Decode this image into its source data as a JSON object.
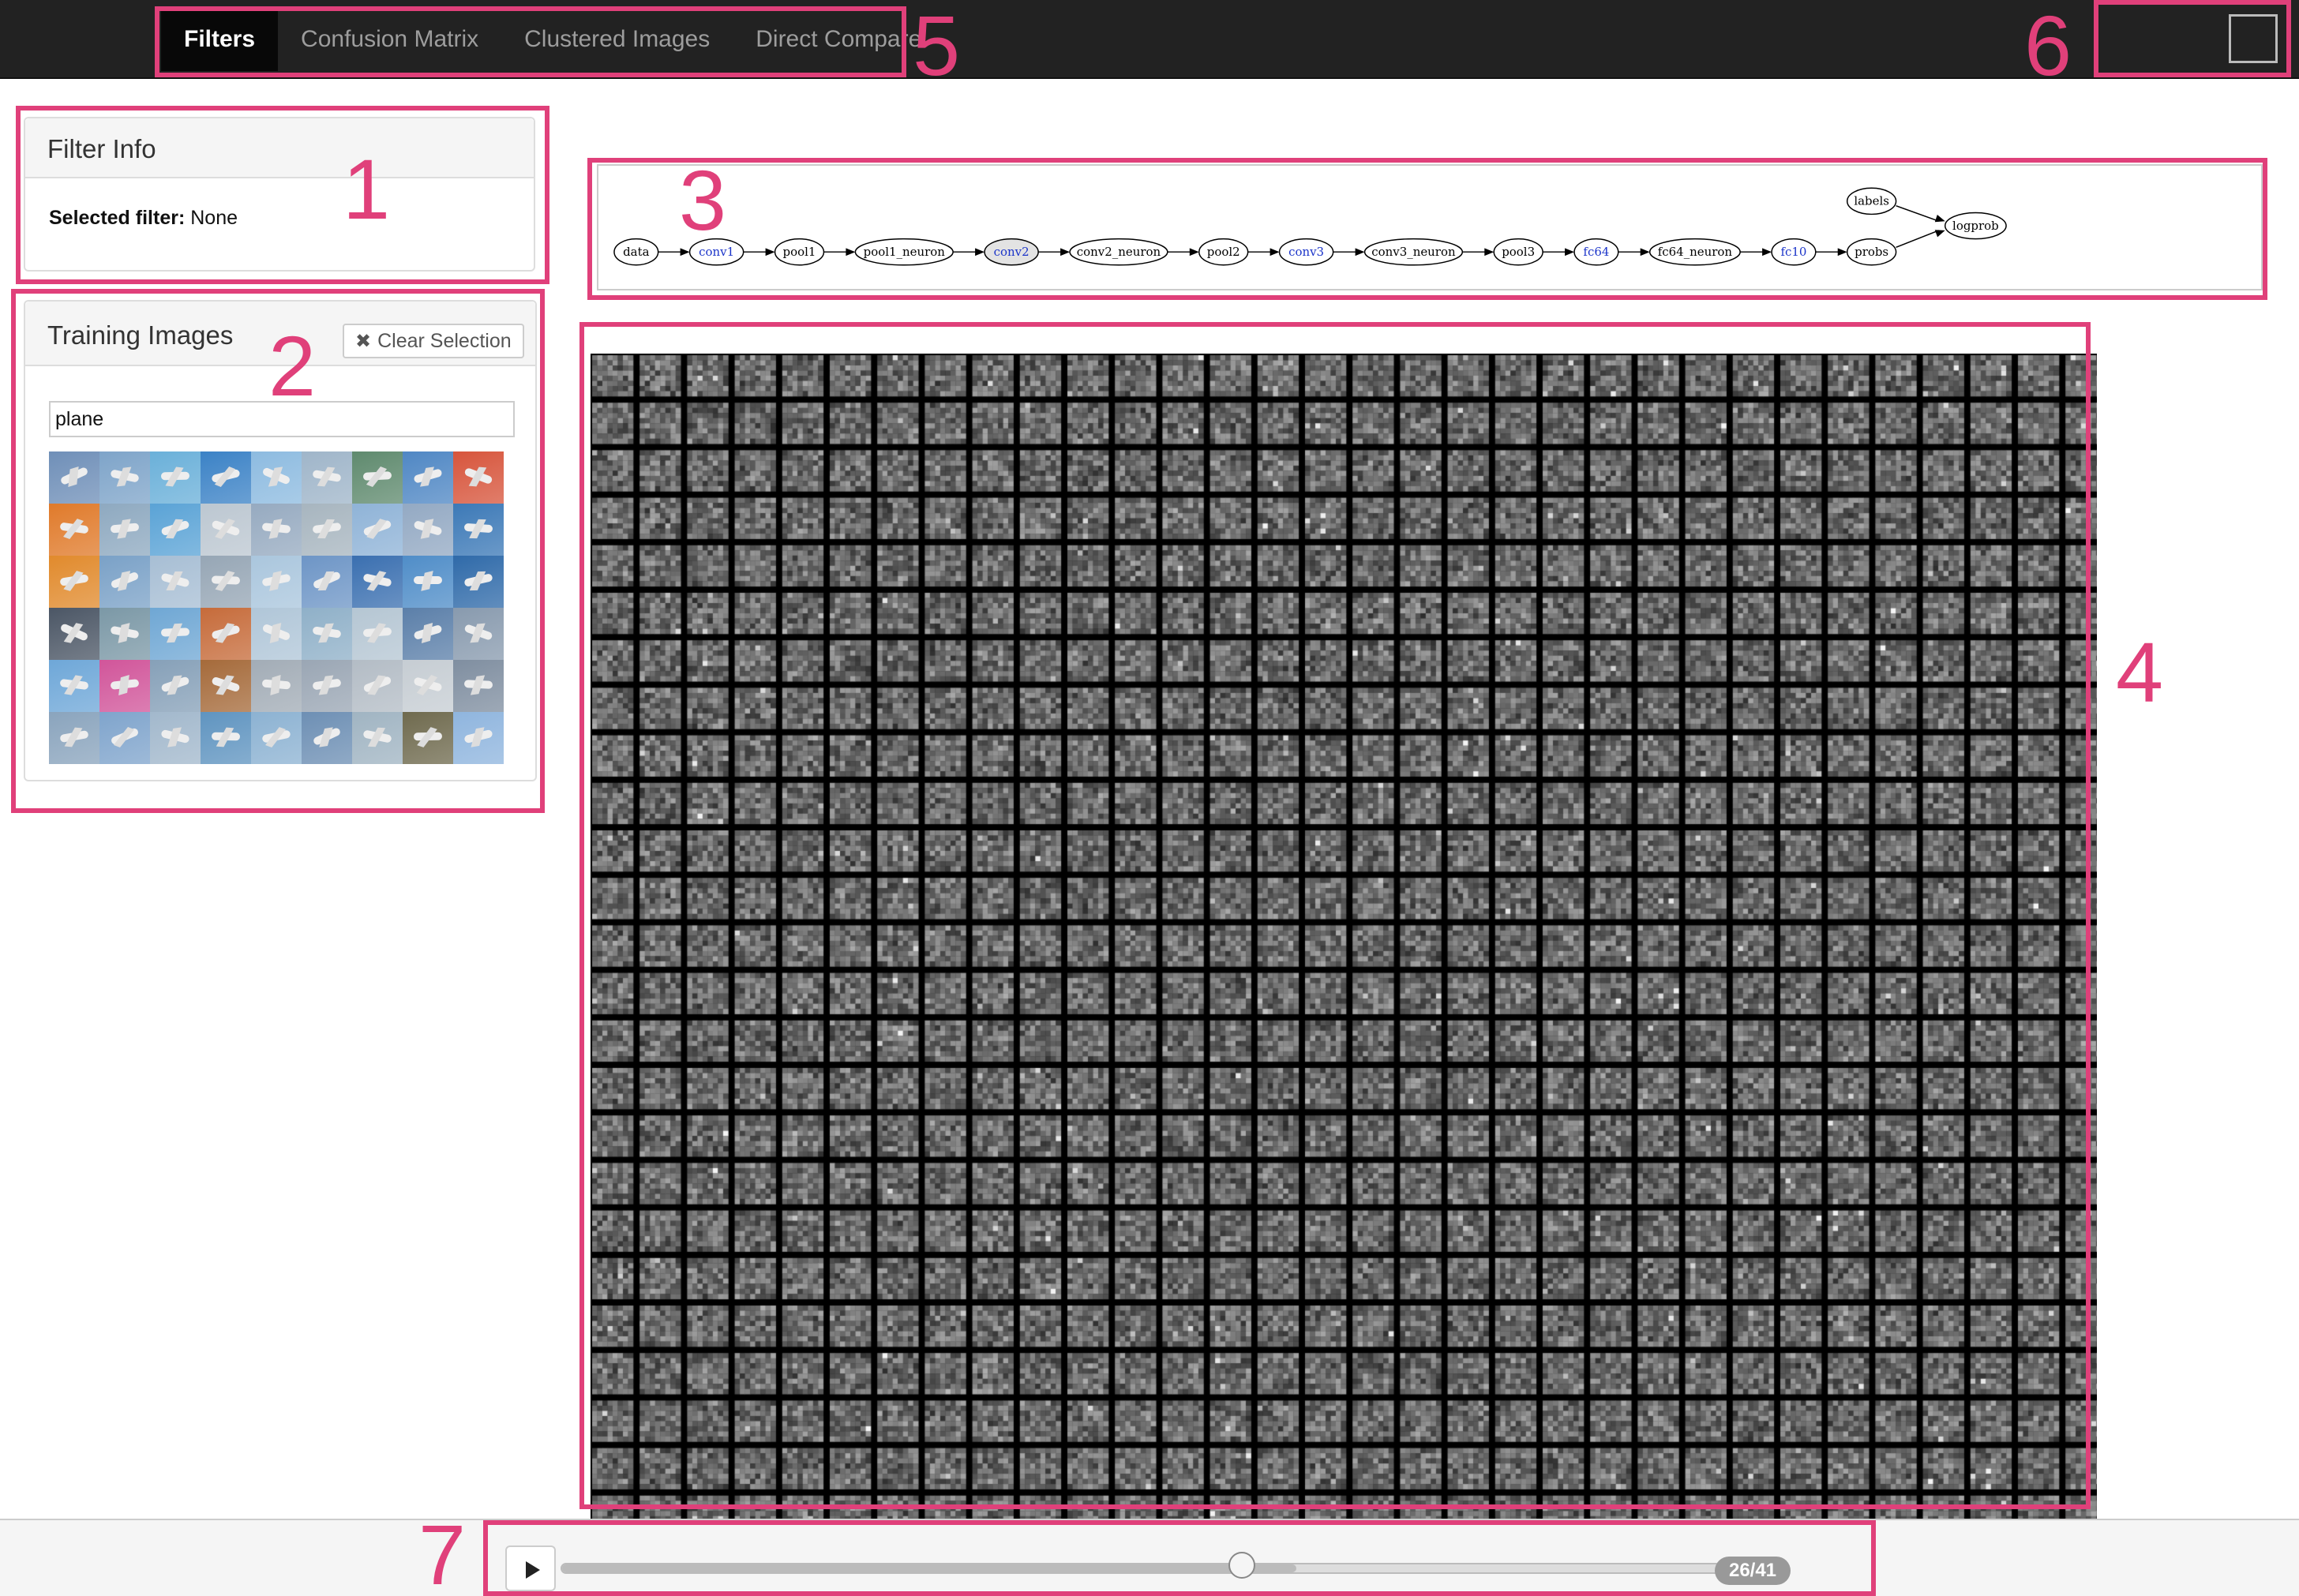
{
  "nav": {
    "tabs": [
      {
        "label": "Filters",
        "active": true
      },
      {
        "label": "Confusion Matrix",
        "active": false
      },
      {
        "label": "Clustered Images",
        "active": false
      },
      {
        "label": "Direct Compare",
        "active": false
      }
    ]
  },
  "filter_info": {
    "title": "Filter Info",
    "selected_label": "Selected filter:",
    "selected_value": "None"
  },
  "training_images": {
    "title": "Training Images",
    "clear_label": "Clear Selection",
    "clear_icon": "x-icon",
    "search_value": "plane",
    "thumb_colors": [
      "#6f8fb8",
      "#7ea4c9",
      "#6ab0d9",
      "#3b82c6",
      "#8dbbe0",
      "#9fb5c9",
      "#5f8a6e",
      "#4f87c4",
      "#d7553c",
      "#e07a2a",
      "#8ea9c0",
      "#5aa3d6",
      "#bcc7d1",
      "#96aac0",
      "#a7b5bf",
      "#8fb3d7",
      "#93a9c3",
      "#3c79b7",
      "#e18a2c",
      "#7aa1c7",
      "#a7bed4",
      "#96a6b5",
      "#aac6dd",
      "#6d95c6",
      "#3a6fb0",
      "#4f8dc8",
      "#2f6aa9",
      "#4b5665",
      "#7b98a6",
      "#6fa7d4",
      "#c66b3a",
      "#b0c6d8",
      "#8fb0c8",
      "#b5c6d3",
      "#5b7fa9",
      "#889aae",
      "#6ea7d8",
      "#d1559a",
      "#86a0b8",
      "#a56a3a",
      "#a2acb6",
      "#9aa6b4",
      "#b3bcc5",
      "#c6cdd3",
      "#7f8ea0",
      "#8aa4bd",
      "#7fa4cc",
      "#a2b8cc",
      "#5f94c0",
      "#8cb2d2",
      "#6d8fb4",
      "#a0b4c2",
      "#6f6a4e",
      "#8fb5de"
    ],
    "annotation": "2"
  },
  "layer_graph": {
    "nodes": [
      {
        "id": "data",
        "label": "data",
        "w": 36,
        "link": false
      },
      {
        "id": "conv1",
        "label": "conv1",
        "w": 44,
        "link": true
      },
      {
        "id": "pool1",
        "label": "pool1",
        "w": 40,
        "link": false
      },
      {
        "id": "pool1_neuron",
        "label": "pool1_neuron",
        "w": 80,
        "link": false
      },
      {
        "id": "conv2",
        "label": "conv2",
        "w": 44,
        "link": true,
        "selected": true
      },
      {
        "id": "conv2_neuron",
        "label": "conv2_neuron",
        "w": 80,
        "link": false
      },
      {
        "id": "pool2",
        "label": "pool2",
        "w": 40,
        "link": false
      },
      {
        "id": "conv3",
        "label": "conv3",
        "w": 44,
        "link": true
      },
      {
        "id": "conv3_neuron",
        "label": "conv3_neuron",
        "w": 80,
        "link": false
      },
      {
        "id": "pool3",
        "label": "pool3",
        "w": 40,
        "link": false
      },
      {
        "id": "fc64",
        "label": "fc64",
        "w": 36,
        "link": true
      },
      {
        "id": "fc64_neuron",
        "label": "fc64_neuron",
        "w": 74,
        "link": false
      },
      {
        "id": "fc10",
        "label": "fc10",
        "w": 36,
        "link": true
      },
      {
        "id": "probs",
        "label": "probs",
        "w": 40,
        "link": false
      },
      {
        "id": "labels",
        "label": "labels",
        "w": 40,
        "link": false
      },
      {
        "id": "logprob",
        "label": "logprob",
        "w": 50,
        "link": false
      }
    ]
  },
  "colors": {
    "annotation": "#e0407a",
    "link_node": "#1b34c9",
    "selected_node_fill": "#e3e3e3"
  },
  "annotations": [
    "1",
    "2",
    "3",
    "4",
    "5",
    "6",
    "7"
  ],
  "slider": {
    "current": 26,
    "total": 41,
    "label": "26/41",
    "play_icon": "play-icon"
  }
}
